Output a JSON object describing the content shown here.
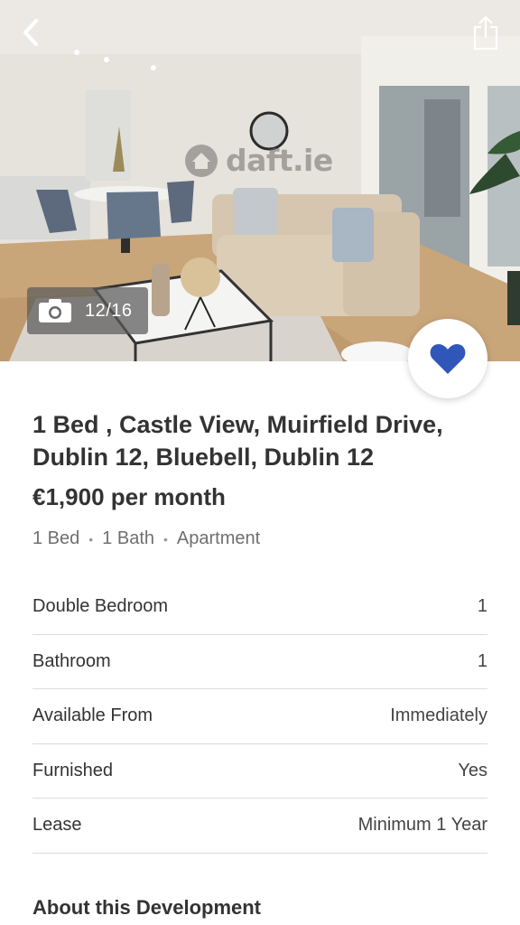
{
  "gallery": {
    "watermark": "daft.ie",
    "current_photo": 12,
    "total_photos": 16,
    "counter_text": "12/16"
  },
  "listing": {
    "title": "1 Bed , Castle View, Muirfield Drive, Dublin 12, Bluebell, Dublin 12",
    "price": "€1,900 per month",
    "specs": [
      "1 Bed",
      "1 Bath",
      "Apartment"
    ],
    "facts": [
      {
        "label": "Double Bedroom",
        "value": "1"
      },
      {
        "label": "Bathroom",
        "value": "1"
      },
      {
        "label": "Available From",
        "value": "Immediately"
      },
      {
        "label": "Furnished",
        "value": "Yes"
      },
      {
        "label": "Lease",
        "value": "Minimum 1 Year"
      }
    ],
    "section_heading": "About this Development"
  },
  "colors": {
    "favorite_heart": "#2f56b8",
    "text_primary": "#333333",
    "text_secondary": "#6f6f6f",
    "divider": "#dcdcdc"
  },
  "icons": {
    "back": "chevron-left-icon",
    "share": "share-icon",
    "camera": "camera-icon",
    "favorite": "heart-icon"
  }
}
